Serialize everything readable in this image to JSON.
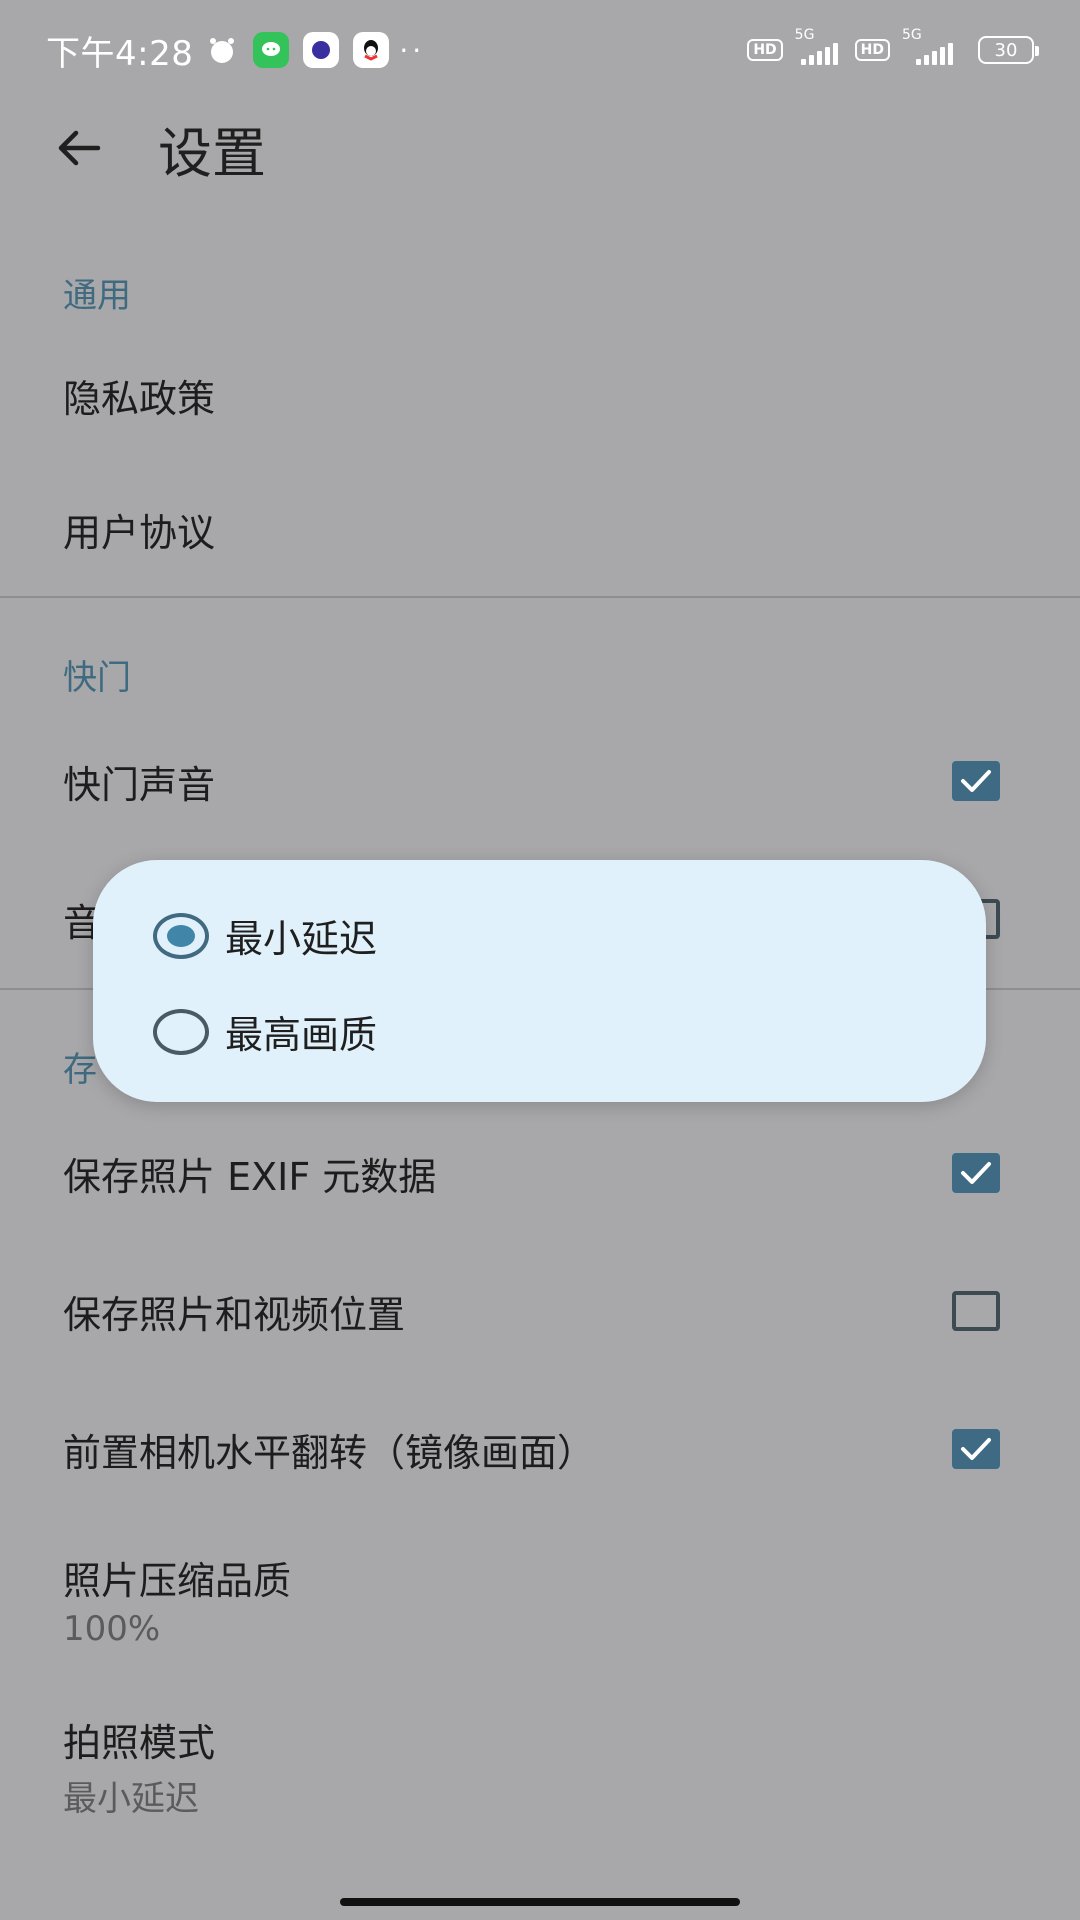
{
  "status_bar": {
    "time": "下午4:28",
    "icons": [
      "alarm-icon",
      "wechat-icon",
      "tieba-icon",
      "qq-icon"
    ],
    "dots": "··",
    "hd1": "HD",
    "net1": "5G",
    "hd2": "HD",
    "net2": "5G",
    "battery": "30"
  },
  "appbar": {
    "title": "设置",
    "back_icon": "arrow-left-icon"
  },
  "sections": {
    "general": {
      "header": "通用",
      "privacy": "隐私政策",
      "agreement": "用户协议"
    },
    "shutter": {
      "header": "快门",
      "sound": "快门声音",
      "sound_checked": true,
      "hidden_item_prefix": "音",
      "hidden_item_checked": false
    },
    "storage": {
      "header_prefix": "存",
      "exif": "保存照片 EXIF 元数据",
      "exif_checked": true,
      "location": "保存照片和视频位置",
      "location_checked": false,
      "mirror": "前置相机水平翻转（镜像画面）",
      "mirror_checked": true,
      "quality_label": "照片压缩品质",
      "quality_value": "100%",
      "mode_label": "拍照模式",
      "mode_value": "最小延迟"
    }
  },
  "dialog": {
    "options": [
      {
        "label": "最小延迟",
        "selected": true
      },
      {
        "label": "最高画质",
        "selected": false
      }
    ]
  },
  "colors": {
    "accent": "#3f6a80",
    "scrim_background": "#a8a8aa",
    "dialog_background": "#e1f1fb",
    "checkbox_on": "#3e6a83"
  }
}
